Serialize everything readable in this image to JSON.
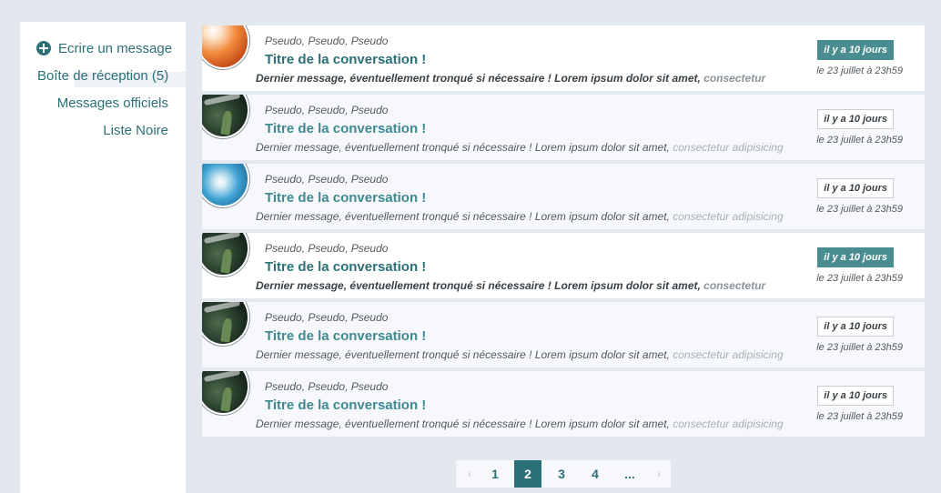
{
  "sidebar": {
    "compose_label": "Ecrire un message",
    "inbox_label": "Boîte de réception (5)",
    "official_label": "Messages officiels",
    "blacklist_label": "Liste Noire"
  },
  "conversations": [
    {
      "avatar": "orange-abstract",
      "participants": "Pseudo, Pseudo, Pseudo",
      "title": "Titre de la conversation !",
      "preview_main": "Dernier message, éventuellement tronqué si nécessaire ! Lorem ipsum dolor sit amet, ",
      "preview_fade": "consectetur",
      "badge": "il y a 10 jours",
      "date": "le 23 juillet à 23h59"
    },
    {
      "avatar": "forest",
      "participants": "Pseudo, Pseudo, Pseudo",
      "title": "Titre de la conversation !",
      "preview_main": "Dernier message, éventuellement tronqué si nécessaire ! Lorem ipsum dolor sit amet, ",
      "preview_fade": "consectetur adipisicing",
      "badge": "il y a 10 jours",
      "date": "le 23 juillet à 23h59"
    },
    {
      "avatar": "sky",
      "participants": "Pseudo, Pseudo, Pseudo",
      "title": "Titre de la conversation !",
      "preview_main": "Dernier message, éventuellement tronqué si nécessaire ! Lorem ipsum dolor sit amet, ",
      "preview_fade": "consectetur adipisicing",
      "badge": "il y a 10 jours",
      "date": "le 23 juillet à 23h59"
    },
    {
      "avatar": "forest",
      "participants": "Pseudo, Pseudo, Pseudo",
      "title": "Titre de la conversation !",
      "preview_main": "Dernier message, éventuellement tronqué si nécessaire ! Lorem ipsum dolor sit amet, ",
      "preview_fade": "consectetur",
      "badge": "il y a 10 jours",
      "date": "le 23 juillet à 23h59"
    },
    {
      "avatar": "forest",
      "participants": "Pseudo, Pseudo, Pseudo",
      "title": "Titre de la conversation !",
      "preview_main": "Dernier message, éventuellement tronqué si nécessaire ! Lorem ipsum dolor sit amet, ",
      "preview_fade": "consectetur adipisicing",
      "badge": "il y a 10 jours",
      "date": "le 23 juillet à 23h59"
    },
    {
      "avatar": "forest",
      "participants": "Pseudo, Pseudo, Pseudo",
      "title": "Titre de la conversation !",
      "preview_main": "Dernier message, éventuellement tronqué si nécessaire ! Lorem ipsum dolor sit amet, ",
      "preview_fade": "consectetur adipisicing",
      "badge": "il y a 10 jours",
      "date": "le 23 juillet à 23h59"
    }
  ],
  "pagination": {
    "prev": "‹",
    "pages": [
      "1",
      "2",
      "3",
      "4",
      "..."
    ],
    "current": "2",
    "next": "›"
  },
  "colors": {
    "accent": "#2b7077",
    "badge_unread": "#4a8d91",
    "background": "#e3e8ef"
  }
}
